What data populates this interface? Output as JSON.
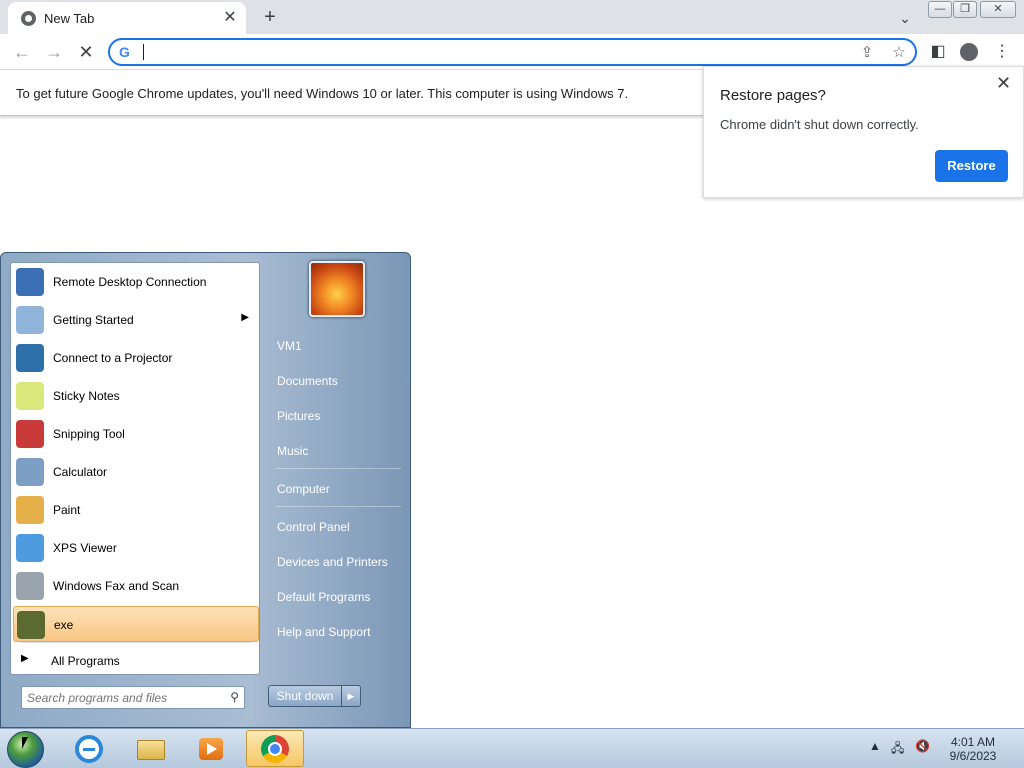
{
  "browser": {
    "tab_title": "New Tab",
    "tab_close": "✕",
    "new_tab": "+",
    "tab_search": "⌄",
    "address_value": "",
    "google_letter": "G",
    "window_controls": {
      "minimize": "—",
      "maximize": "❐",
      "close": "✕"
    }
  },
  "infobar": {
    "message": "To get future Google Chrome updates, you'll need Windows 10 or later. This computer is using Windows 7."
  },
  "restore_bubble": {
    "title": "Restore pages?",
    "message": "Chrome didn't shut down correctly.",
    "button": "Restore",
    "close": "✕"
  },
  "start_menu": {
    "programs": [
      {
        "label": "Remote Desktop Connection",
        "icon": "remote-desktop-icon",
        "color": "#3b6fb6"
      },
      {
        "label": "Getting Started",
        "icon": "getting-started-icon",
        "color": "#8fb3d9",
        "submenu": true
      },
      {
        "label": "Connect to a Projector",
        "icon": "projector-icon",
        "color": "#2d6fa8"
      },
      {
        "label": "Sticky Notes",
        "icon": "sticky-notes-icon",
        "color": "#d8e87a"
      },
      {
        "label": "Snipping Tool",
        "icon": "scissors-icon",
        "color": "#c93b3b"
      },
      {
        "label": "Calculator",
        "icon": "calculator-icon",
        "color": "#7d9fc4"
      },
      {
        "label": "Paint",
        "icon": "paint-icon",
        "color": "#e5b04a"
      },
      {
        "label": "XPS Viewer",
        "icon": "xps-viewer-icon",
        "color": "#4e9be0"
      },
      {
        "label": "Windows Fax and Scan",
        "icon": "fax-scan-icon",
        "color": "#9aa4ae"
      },
      {
        "label": "exe",
        "icon": "exe-icon",
        "color": "#5b6b2f",
        "highlighted": true
      }
    ],
    "all_programs": "All Programs",
    "search_placeholder": "Search programs and files",
    "right_items": [
      "VM1",
      "Documents",
      "Pictures",
      "Music",
      "Computer",
      "Control Panel",
      "Devices and Printers",
      "Default Programs",
      "Help and Support"
    ],
    "shutdown": "Shut down",
    "shutdown_arrow": "▶"
  },
  "taskbar": {
    "time": "4:01 AM",
    "date": "9/6/2023",
    "tray_arrow": "▲"
  }
}
